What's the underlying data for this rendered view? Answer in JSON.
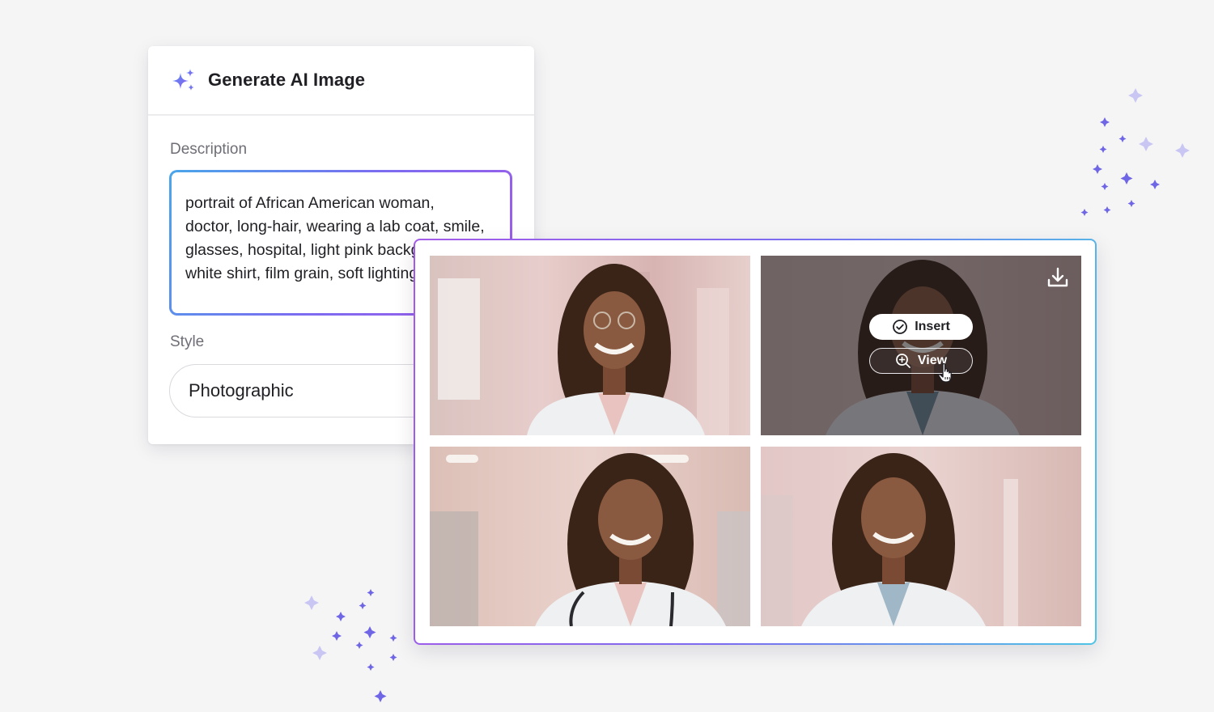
{
  "panel": {
    "title": "Generate AI Image",
    "title_icon": "sparkles-icon",
    "description_label": "Description",
    "description_value": "portrait of African American woman,\ndoctor, long-hair, wearing a lab coat, smile,\nglasses, hospital, light pink background,\nwhite shirt, film grain, soft lighting",
    "style_label": "Style",
    "style_value": "Photographic"
  },
  "results": {
    "images": [
      {
        "name": "generated-image-1"
      },
      {
        "name": "generated-image-2",
        "hovered": true
      },
      {
        "name": "generated-image-3"
      },
      {
        "name": "generated-image-4"
      }
    ],
    "insert_label": "Insert",
    "view_label": "View",
    "download_icon": "download-icon"
  },
  "colors": {
    "accent_blue": "#4aa6ea",
    "accent_purple": "#a35ae8",
    "sparkle": "#6f66e6"
  }
}
